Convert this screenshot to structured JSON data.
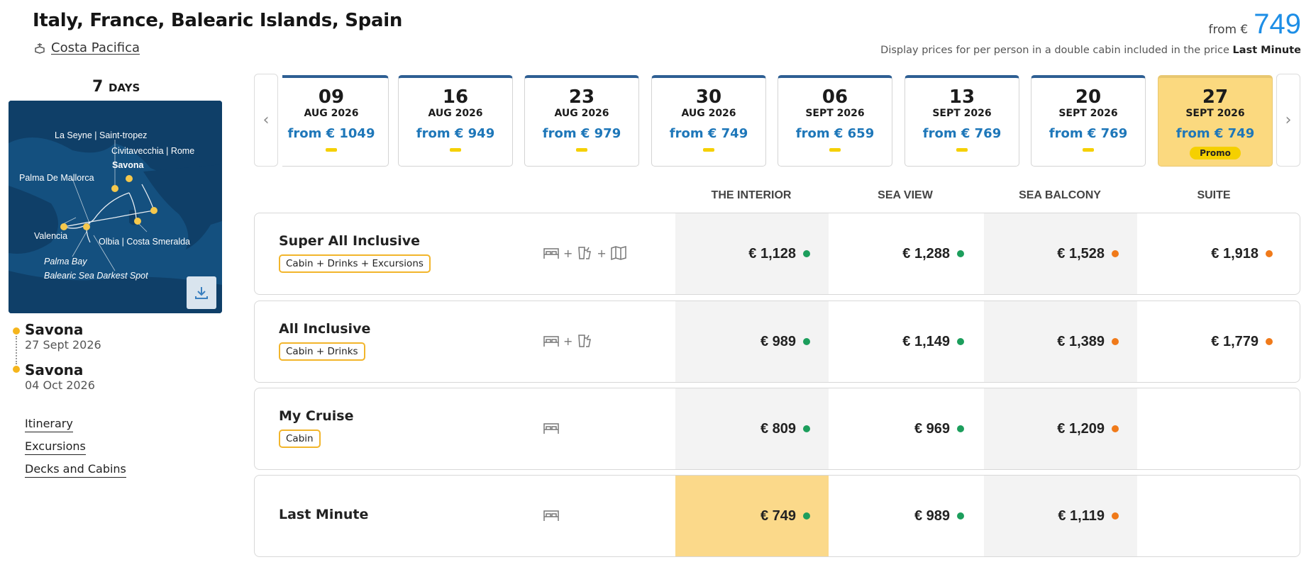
{
  "header": {
    "title": "Italy, France, Balearic Islands, Spain",
    "ship": "Costa Pacifica",
    "from_label": "from €",
    "price": "749",
    "disclaimer_prefix": "Display prices for per person in a double cabin included in the price",
    "disclaimer_bold": "Last Minute"
  },
  "duration": {
    "number": "7",
    "unit": "DAYS"
  },
  "map": {
    "labels": [
      "La Seyne | Saint-tropez",
      "Civitavecchia | Rome",
      "Savona",
      "Palma De Mallorca",
      "Valencia",
      "Olbia | Costa Smeralda",
      "Palma Bay",
      "Balearic Sea Darkest Spot"
    ],
    "download_icon": "download-icon"
  },
  "itinerary": {
    "start_port": "Savona",
    "start_date": "27 Sept 2026",
    "end_port": "Savona",
    "end_date": "04 Oct 2026"
  },
  "links": [
    "Itinerary",
    "Excursions",
    "Decks and Cabins"
  ],
  "dates": [
    {
      "day": "09",
      "month": "AUG 2026",
      "price": "from € 1049"
    },
    {
      "day": "16",
      "month": "AUG 2026",
      "price": "from € 949"
    },
    {
      "day": "23",
      "month": "AUG 2026",
      "price": "from € 979"
    },
    {
      "day": "30",
      "month": "AUG 2026",
      "price": "from € 749"
    },
    {
      "day": "06",
      "month": "SEPT 2026",
      "price": "from € 659"
    },
    {
      "day": "13",
      "month": "SEPT 2026",
      "price": "from € 769"
    },
    {
      "day": "20",
      "month": "SEPT 2026",
      "price": "from € 769"
    },
    {
      "day": "27",
      "month": "SEPT 2026",
      "price": "from € 749",
      "badge": "Promo",
      "selected": true
    }
  ],
  "columns": [
    "THE INTERIOR",
    "SEA VIEW",
    "SEA BALCONY",
    "SUITE"
  ],
  "rows": [
    {
      "name": "Super All Inclusive",
      "tag": "Cabin + Drinks + Excursions",
      "icons": [
        "bed-icon",
        "drink-icon",
        "map-icon"
      ],
      "prices": [
        "€ 1,128",
        "€ 1,288",
        "€ 1,528",
        "€ 1,918"
      ],
      "status": [
        "green",
        "green",
        "orange",
        "orange"
      ]
    },
    {
      "name": "All Inclusive",
      "tag": "Cabin + Drinks",
      "icons": [
        "bed-icon",
        "drink-icon"
      ],
      "prices": [
        "€ 989",
        "€ 1,149",
        "€ 1,389",
        "€ 1,779"
      ],
      "status": [
        "green",
        "green",
        "orange",
        "orange"
      ]
    },
    {
      "name": "My Cruise",
      "tag": "Cabin",
      "icons": [
        "bed-icon"
      ],
      "prices": [
        "€ 809",
        "€ 969",
        "€ 1,209",
        ""
      ],
      "status": [
        "green",
        "green",
        "orange",
        ""
      ]
    },
    {
      "name": "Last Minute",
      "tag": "",
      "icons": [
        "bed-icon"
      ],
      "prices": [
        "€ 749",
        "€ 989",
        "€ 1,119",
        ""
      ],
      "status": [
        "green",
        "green",
        "orange",
        ""
      ]
    }
  ],
  "colors": {
    "accent": "#1d8ee6",
    "highlight": "#fbd98a",
    "green": "#1c9e5c",
    "orange": "#f07a1a"
  }
}
